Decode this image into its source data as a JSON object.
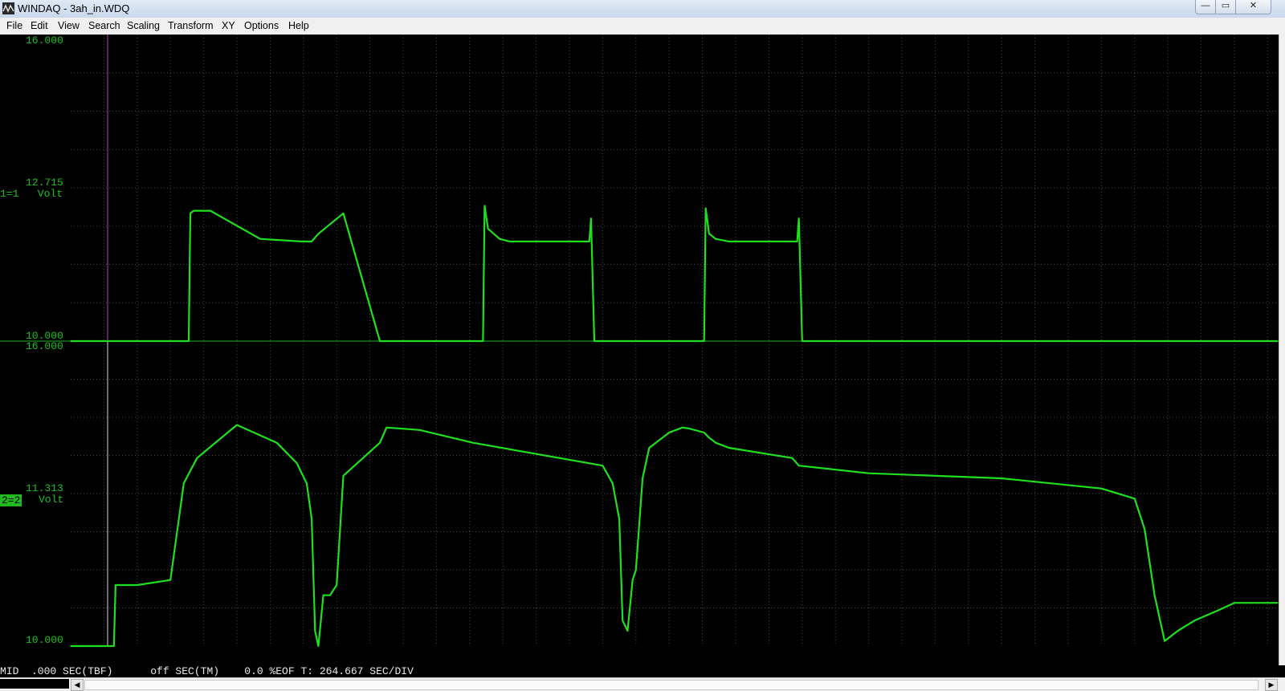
{
  "window": {
    "title": "WINDAQ - 3ah_in.WDQ",
    "icon": "windaq-app-icon",
    "controls": {
      "minimize": "—",
      "maximize": "▭",
      "close": "✕"
    }
  },
  "menu": [
    "File",
    "Edit",
    "View",
    "Search",
    "Scaling",
    "Transform",
    "XY",
    "Options",
    "Help"
  ],
  "colors": {
    "trace": "#1fe01f",
    "grid": "#4a4a4a",
    "cursor": "#c040c0",
    "background": "#000000"
  },
  "channels": [
    {
      "top_label": "16.000",
      "mid_value": "12.715",
      "bottom_label": "10.000",
      "channel_label": "1=1   Volt",
      "selected": false
    },
    {
      "top_label": "16.000",
      "mid_value": "11.313",
      "bottom_label": "10.000",
      "channel_id": "2=2",
      "unit": "Volt",
      "selected": true
    }
  ],
  "status": "MID  .000 SEC(TBF)      off SEC(TM)    0.0 %EOF T: 264.667 SEC/DIV",
  "chart_data": [
    {
      "type": "line",
      "name": "1=1",
      "ylim": [
        10,
        16
      ],
      "x": [
        0,
        0.8,
        1.1,
        1.3,
        2.0,
        2.6,
        3.4,
        3.45,
        3.55,
        3.6,
        3.7,
        4.2,
        5.7,
        6.95,
        7.0,
        7.1,
        7.25,
        7.45,
        8.2,
        9.3,
        9.35,
        9.45,
        9.85,
        10.0,
        10.1,
        10.2,
        10.3,
        10.6,
        11.4,
        12.1,
        12.2,
        12.3,
        12.4,
        12.45,
        12.55,
        12.9,
        13.2,
        13.35,
        13.5,
        13.6,
        13.9,
        14.45,
        15.6,
        15.65,
        15.75,
        16.2,
        19.05,
        19.1,
        19.2,
        19.4,
        19.8,
        21.7,
        21.85,
        21.9,
        22.0,
        28.0,
        36.3
      ],
      "y": [
        10.0,
        10.0,
        10.0,
        10.0,
        10.0,
        10.0,
        10.0,
        10.0,
        10.0,
        12.5,
        12.55,
        12.55,
        12.0,
        11.95,
        11.95,
        11.95,
        11.95,
        12.1,
        12.5,
        10.0,
        10.0,
        10.0,
        10.0,
        10.0,
        10.0,
        10.0,
        10.0,
        10.0,
        10.0,
        10.0,
        10.0,
        10.0,
        10.0,
        12.65,
        12.2,
        12.0,
        11.95,
        11.95,
        11.95,
        11.95,
        11.95,
        11.95,
        11.95,
        12.4,
        10.0,
        10.0,
        10.0,
        12.6,
        12.1,
        12.0,
        11.95,
        11.95,
        11.95,
        12.4,
        10.0,
        10.0,
        10.0
      ]
    },
    {
      "type": "line",
      "name": "2=2",
      "ylim": [
        10,
        16
      ],
      "x": [
        0,
        0.8,
        1.0,
        1.3,
        1.35,
        2.0,
        3.0,
        3.4,
        3.8,
        5.0,
        6.2,
        6.8,
        7.1,
        7.25,
        7.35,
        7.45,
        7.6,
        7.8,
        8.0,
        8.2,
        9.3,
        9.5,
        10.5,
        12.1,
        16.0,
        16.3,
        16.5,
        16.6,
        16.75,
        16.9,
        17.0,
        17.2,
        17.4,
        18.0,
        18.4,
        18.6,
        19.05,
        19.2,
        19.4,
        19.8,
        21.7,
        21.9,
        24.0,
        28.0,
        31.0,
        32.0,
        32.3,
        32.6,
        32.9,
        33.3,
        33.8,
        34.5,
        35.0,
        36.3
      ],
      "y": [
        10.0,
        10.0,
        10.0,
        10.0,
        11.2,
        11.2,
        11.3,
        13.2,
        13.7,
        14.35,
        14.0,
        13.6,
        13.2,
        12.5,
        10.3,
        10.0,
        11.0,
        11.0,
        11.2,
        13.35,
        14.0,
        14.3,
        14.25,
        14.0,
        13.55,
        13.2,
        12.5,
        10.5,
        10.3,
        11.3,
        11.5,
        13.3,
        13.9,
        14.2,
        14.3,
        14.28,
        14.2,
        14.1,
        14.0,
        13.9,
        13.7,
        13.55,
        13.4,
        13.3,
        13.1,
        12.9,
        12.3,
        11.0,
        10.1,
        10.3,
        10.5,
        10.7,
        10.85,
        10.85
      ]
    }
  ]
}
